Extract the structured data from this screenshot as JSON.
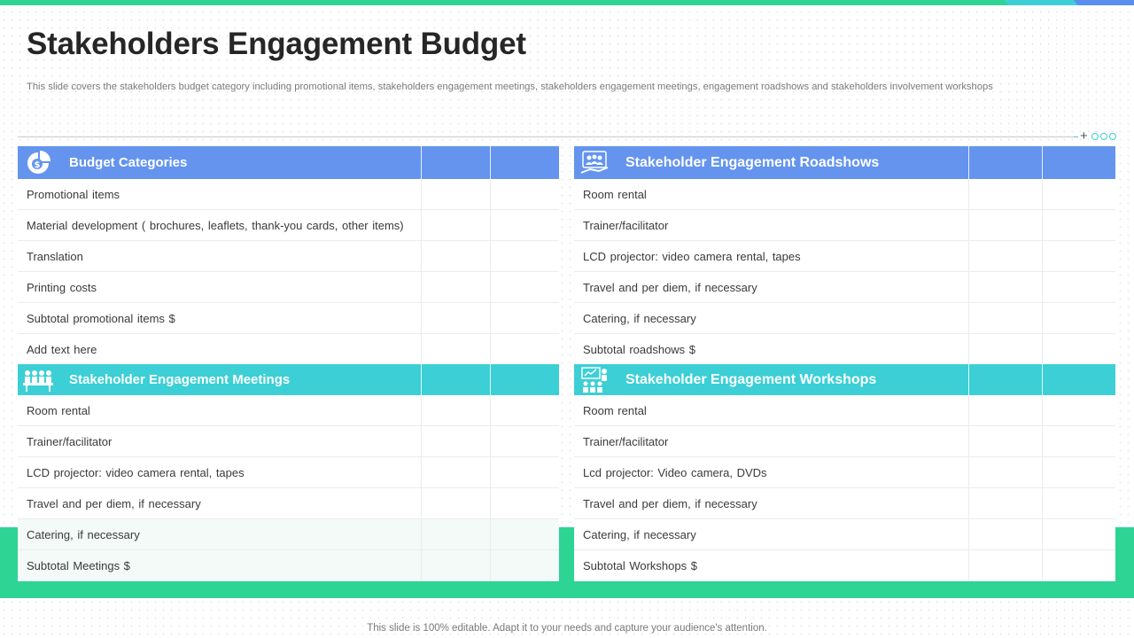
{
  "title": "Stakeholders Engagement Budget",
  "subtitle": "This slide covers the stakeholders budget category including promotional items, stakeholders engagement meetings, stakeholders engagement meetings, engagement roadshows and stakeholders involvement workshops",
  "colors": {
    "accent_green": "#2ed494",
    "header_blue": "#6494ee",
    "header_teal": "#3ccfd5"
  },
  "panels": {
    "budget_categories": {
      "title": "Budget Categories",
      "icon": "money-chart-icon",
      "rows": [
        "Promotional items",
        "Material development  ( brochures,  leaflets,  thank-you cards,  other items)",
        "Translation",
        "Printing costs",
        "Subtotal promotional  items $",
        "Add text here"
      ]
    },
    "roadshows": {
      "title": "Stakeholder Engagement Roadshows",
      "icon": "roadshow-audience-icon",
      "rows": [
        "Room rental",
        "Trainer/facilitator",
        "LCD projector:  video  camera rental,  tapes",
        "Travel  and per diem,  if necessary",
        "Catering,  if necessary",
        "Subtotal roadshows  $"
      ]
    },
    "meetings": {
      "title": "Stakeholder Engagement Meetings",
      "icon": "meeting-table-icon",
      "rows": [
        "Room rental",
        "Trainer/facilitator",
        "LCD projector:  video  camera rental,  tapes",
        "Travel  and per diem,  if necessary",
        "Catering,  if necessary",
        "Subtotal Meetings $"
      ]
    },
    "workshops": {
      "title": "Stakeholder Engagement Workshops",
      "icon": "workshop-presentation-icon",
      "rows": [
        "Room rental",
        "Trainer/facilitator",
        "Lcd projector:  Video camera,  DVDs",
        "Travel  and per diem,  if necessary",
        "Catering,  if necessary",
        "Subtotal Workshops $"
      ]
    }
  },
  "footer": "This slide is 100% editable. Adapt it to your needs and capture your audience's attention."
}
